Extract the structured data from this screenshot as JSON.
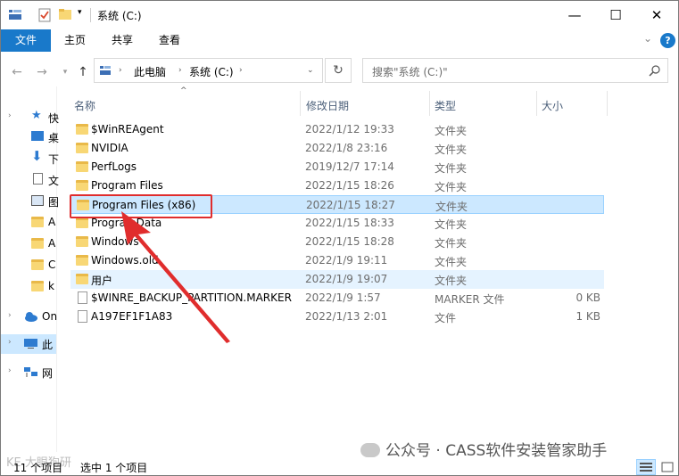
{
  "window": {
    "title": "系统 (C:)",
    "controls": {
      "minimize": "—",
      "maximize": "☐",
      "close": "✕"
    }
  },
  "ribbon": {
    "tabs": [
      "文件",
      "主页",
      "共享",
      "查看"
    ],
    "expand": "⌄",
    "help": "?"
  },
  "address": {
    "segments": [
      "此电脑",
      "系统 (C:)"
    ],
    "search_placeholder": "搜索\"系统 (C:)\""
  },
  "nav": {
    "items": [
      {
        "label": "快",
        "icon": "star-icon"
      },
      {
        "label": "桌",
        "icon": "desktop-icon"
      },
      {
        "label": "下",
        "icon": "download-icon"
      },
      {
        "label": "文",
        "icon": "document-icon"
      },
      {
        "label": "图",
        "icon": "picture-icon"
      },
      {
        "label": "A",
        "icon": "folder-icon"
      },
      {
        "label": "A",
        "icon": "folder-icon"
      },
      {
        "label": "C",
        "icon": "folder-icon"
      },
      {
        "label": "k",
        "icon": "folder-icon"
      },
      {
        "label": "On",
        "icon": "cloud-icon"
      },
      {
        "label": "此",
        "icon": "computer-icon"
      },
      {
        "label": "网",
        "icon": "network-icon"
      }
    ]
  },
  "columns": {
    "name": "名称",
    "date": "修改日期",
    "type": "类型",
    "size": "大小"
  },
  "files": [
    {
      "name": "$WinREAgent",
      "date": "2022/1/12 19:33",
      "type": "文件夹",
      "size": "",
      "kind": "folder"
    },
    {
      "name": "NVIDIA",
      "date": "2022/1/8 23:16",
      "type": "文件夹",
      "size": "",
      "kind": "folder"
    },
    {
      "name": "PerfLogs",
      "date": "2019/12/7 17:14",
      "type": "文件夹",
      "size": "",
      "kind": "folder"
    },
    {
      "name": "Program Files",
      "date": "2022/1/15 18:26",
      "type": "文件夹",
      "size": "",
      "kind": "folder"
    },
    {
      "name": "Program Files (x86)",
      "date": "2022/1/15 18:27",
      "type": "文件夹",
      "size": "",
      "kind": "folder"
    },
    {
      "name": "ProgramData",
      "date": "2022/1/15 18:33",
      "type": "文件夹",
      "size": "",
      "kind": "folder"
    },
    {
      "name": "Windows",
      "date": "2022/1/15 18:28",
      "type": "文件夹",
      "size": "",
      "kind": "folder"
    },
    {
      "name": "Windows.old",
      "date": "2022/1/9 19:11",
      "type": "文件夹",
      "size": "",
      "kind": "folder"
    },
    {
      "name": "用户",
      "date": "2022/1/9 19:07",
      "type": "文件夹",
      "size": "",
      "kind": "folder"
    },
    {
      "name": "$WINRE_BACKUP_PARTITION.MARKER",
      "date": "2022/1/9 1:57",
      "type": "MARKER 文件",
      "size": "0 KB",
      "kind": "file"
    },
    {
      "name": "A197EF1F1A83",
      "date": "2022/1/13 2:01",
      "type": "文件",
      "size": "1 KB",
      "kind": "file"
    }
  ],
  "selected_index": 4,
  "status": {
    "count": "11 个项目",
    "selected": "选中 1 个项目"
  },
  "watermark": "公众号 · CASS软件安装管家助手",
  "watermark_left": "KE 大眼狗研",
  "accent": "#1979ca",
  "highlight_color": "#e02d2d"
}
